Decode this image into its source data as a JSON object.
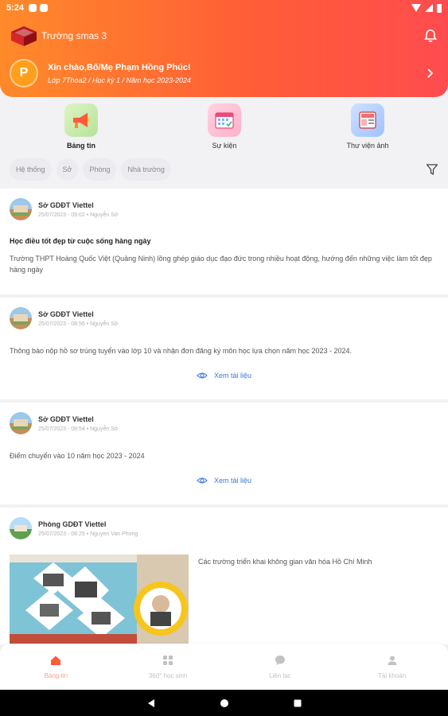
{
  "status_bar": {
    "time": "5:24"
  },
  "header": {
    "school_name": "Trường smas 3",
    "greeting": "Xin chào,Bố/Mẹ Phạm Hồng Phúc!",
    "subtitle": "Lớp 7Thoa2 / Học kỳ 1 / Năm học 2023-2024",
    "avatar_letter": "P"
  },
  "shortcuts": [
    {
      "label": "Bảng tin",
      "icon": "megaphone-icon",
      "active": true
    },
    {
      "label": "Sự kiện",
      "icon": "calendar-icon",
      "active": false
    },
    {
      "label": "Thư viện ảnh",
      "icon": "photo-library-icon",
      "active": false
    }
  ],
  "filters": [
    "Hệ thống",
    "Sở",
    "Phòng",
    "Nhà trường"
  ],
  "posts": [
    {
      "org": "Sở GDĐT Viettel",
      "time": "25/07/2023 - 09:02 • Nguyễn Sở",
      "title": "Học điều tốt đẹp từ cuộc sống hàng ngày",
      "body": "Trường THPT Hoàng Quốc Việt (Quảng Ninh) lồng ghép giáo dục đạo đức trong nhiều hoạt động, hướng đến những việc làm tốt đẹp hàng ngày"
    },
    {
      "org": "Sở GDĐT Viettel",
      "time": "25/07/2023 - 08:56 • Nguyễn Sở",
      "body": "Thông báo nộp hồ sơ trúng tuyển vào lớp 10 và nhận đơn đăng ký môn học lựa chọn năm học 2023 - 2024.",
      "link": "Xem tài liệu"
    },
    {
      "org": "Sở GDĐT Viettel",
      "time": "25/07/2023 - 08:54 • Nguyễn Sở",
      "body": "Điểm chuyển vào 10 năm học 2023 - 2024",
      "link": "Xem tài liệu"
    },
    {
      "org": "Phòng GDĐT Viettel",
      "time": "25/07/2023 - 08:25 • Nguyen Van Phong",
      "body": "Các trường triển khai không gian văn hóa Hồ Chí Minh"
    }
  ],
  "bottom_nav": [
    {
      "label": "Bảng tin",
      "icon": "home-icon",
      "active": true
    },
    {
      "label": "360° học sinh",
      "icon": "grid-icon",
      "active": false
    },
    {
      "label": "Liên lạc",
      "icon": "chat-icon",
      "active": false
    },
    {
      "label": "Tài khoản",
      "icon": "user-icon",
      "active": false
    }
  ],
  "colors": {
    "accent": "#ff5a3c",
    "link": "#3b78d8"
  }
}
